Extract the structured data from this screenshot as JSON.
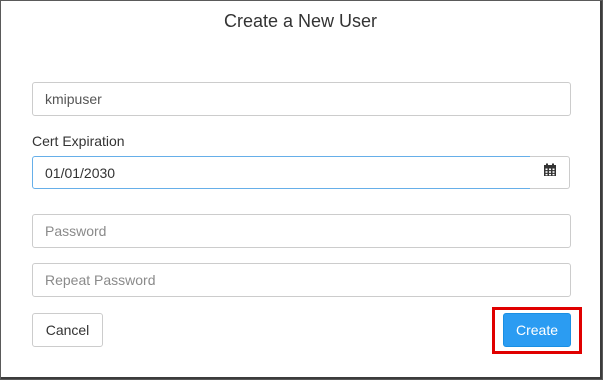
{
  "dialog": {
    "title": "Create a New User"
  },
  "form": {
    "username_value": "kmipuser",
    "cert_expiration_label": "Cert Expiration",
    "cert_expiration_value": "01/01/2030",
    "password_placeholder": "Password",
    "repeat_password_placeholder": "Repeat Password",
    "calendar_icon": "calendar-icon"
  },
  "actions": {
    "cancel_label": "Cancel",
    "create_label": "Create"
  },
  "colors": {
    "primary": "#2b9cf2",
    "focus_border": "#66afe9",
    "highlight": "#e00000"
  }
}
